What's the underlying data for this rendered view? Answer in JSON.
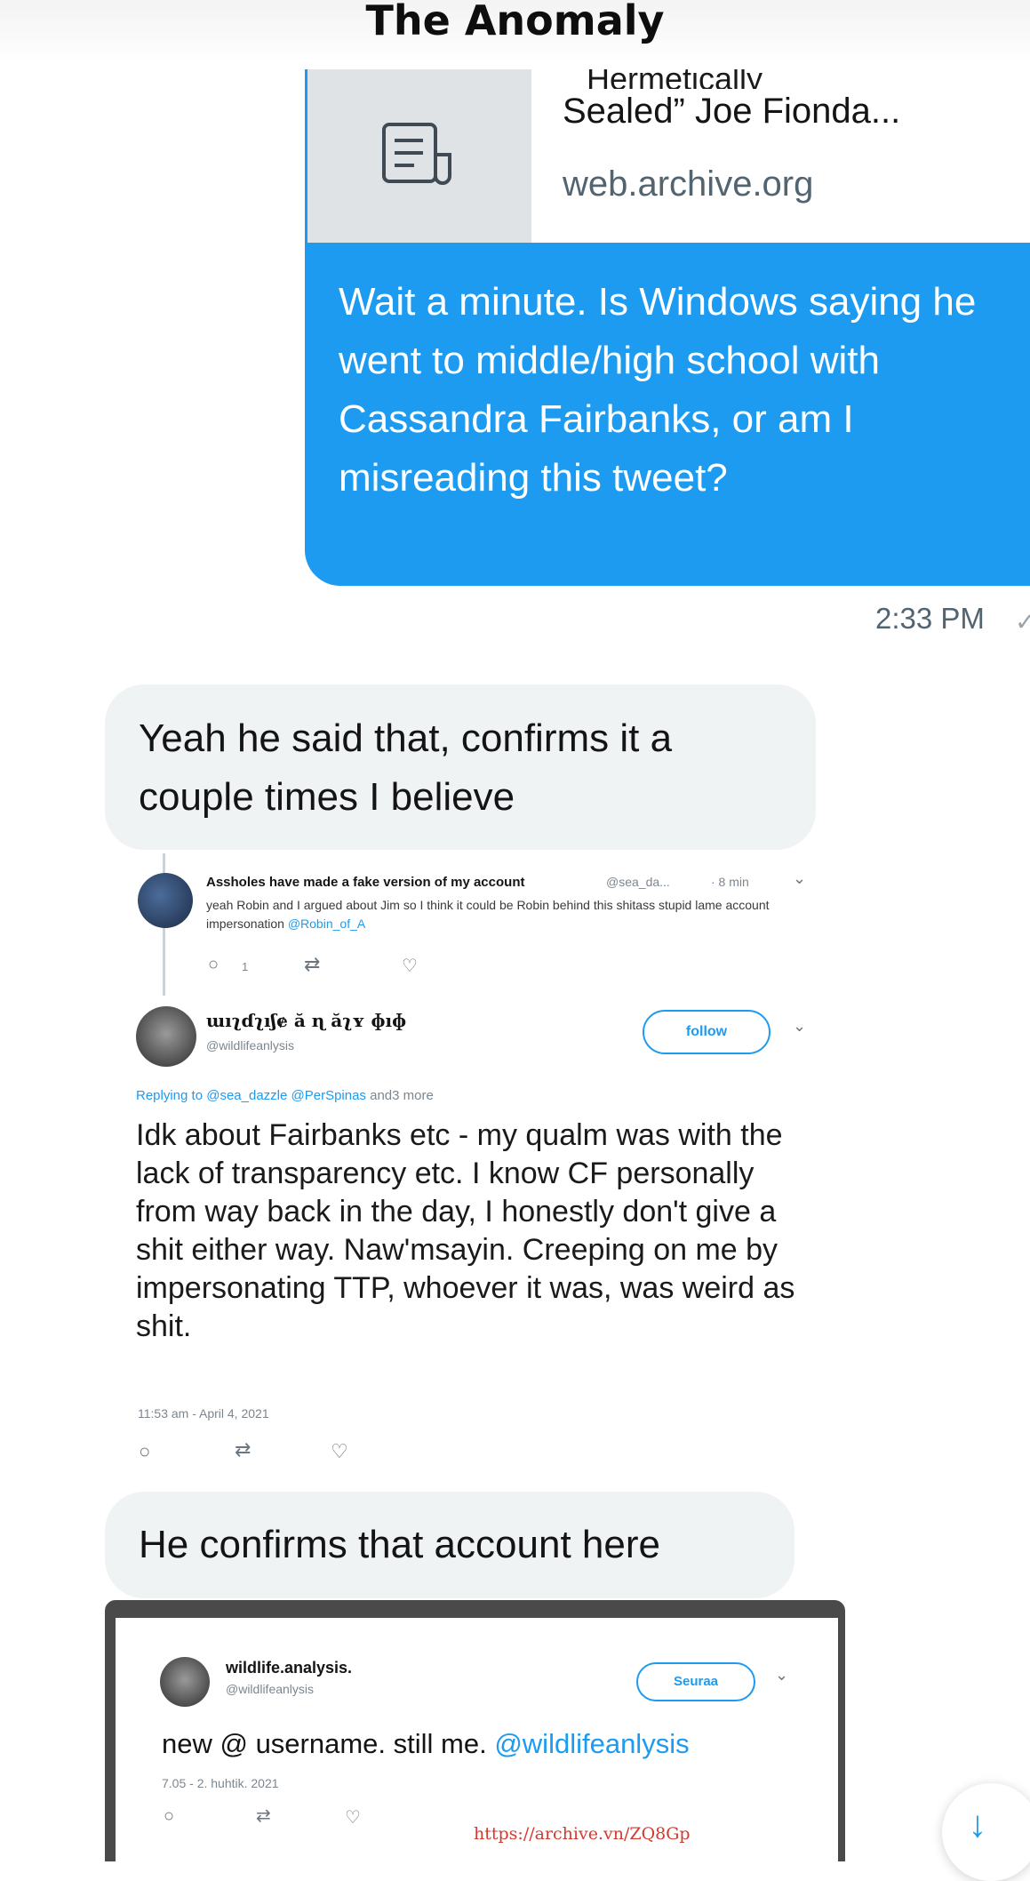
{
  "header": {
    "title": "The Anomaly"
  },
  "link_preview": {
    "title_cut": "Hermetically",
    "title": "Sealed” Joe Fionda...",
    "domain": "web.archive.org",
    "thumb_icon": "document-icon"
  },
  "outgoing_message": {
    "text": "Wait a minute. Is Windows saying he went to middle/high school with Cassandra Fairbanks, or am I misreading this tweet?",
    "time": "2:33 PM"
  },
  "incoming_1": {
    "text": "Yeah he said that, confirms it a couple times I believe"
  },
  "tweet_a": {
    "name": "Assholes have made a fake version of my account",
    "handle": "@sea_da...",
    "age": "· 8 min",
    "text": "yeah Robin and I argued about Jim so I think it could be Robin behind this shitass stupid lame account impersonation",
    "mention": "@Robin_of_A",
    "reply_count": "1"
  },
  "tweet_b": {
    "name": "ɯıʅɗʅıʃɇ ă ɳ ăʅʏ ɸıɸ",
    "handle": "@wildlifeanlysis",
    "follow_label": "follow",
    "replying_prefix": "Replying to",
    "replying_mentions": "@sea_dazzle @PerSpinas",
    "replying_suffix": "and3 more",
    "text": "Idk about Fairbanks etc - my qualm was with the lack of transparency etc. I know CF personally from way back in the day, I honestly don't give a shit either way. Naw'msayin. Creeping on me by impersonating TTP, whoever it was, was weird as shit.",
    "date": "11:53 am - April 4, 2021"
  },
  "incoming_2": {
    "text": "He confirms that account here"
  },
  "tweet_c": {
    "name": "wildlife.analysis.",
    "handle": "@wildlifeanlysis",
    "follow_label": "Seuraa",
    "text_prefix": "new @ username. still me.",
    "mention": "@wildlifeanlysis",
    "date": "7.05 - 2. huhtik. 2021"
  },
  "archive_url": "https://archive.vn/ZQ8Gp",
  "colors": {
    "accent": "#1d9bf0",
    "bubble_grey": "#eff3f4"
  }
}
